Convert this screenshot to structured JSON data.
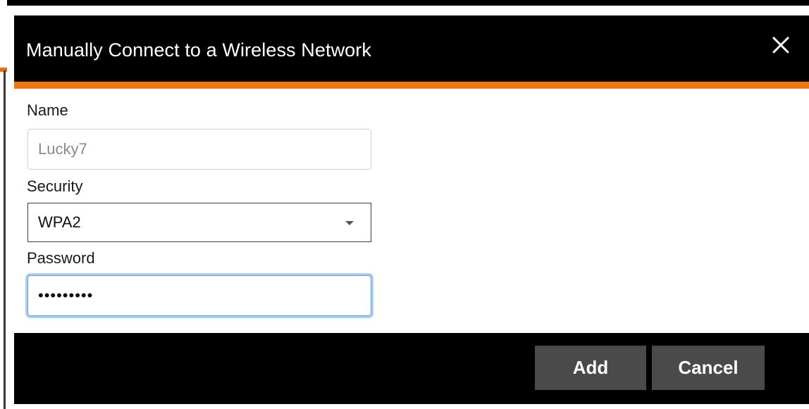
{
  "dialog": {
    "title": "Manually Connect to a Wireless Network",
    "accent_color": "#f07612",
    "close_icon": "close-icon"
  },
  "form": {
    "name": {
      "label": "Name",
      "placeholder": "Lucky7",
      "value": ""
    },
    "security": {
      "label": "Security",
      "selected": "WPA2"
    },
    "password": {
      "label": "Password",
      "value": "•••••••••"
    }
  },
  "footer": {
    "add_label": "Add",
    "cancel_label": "Cancel"
  }
}
